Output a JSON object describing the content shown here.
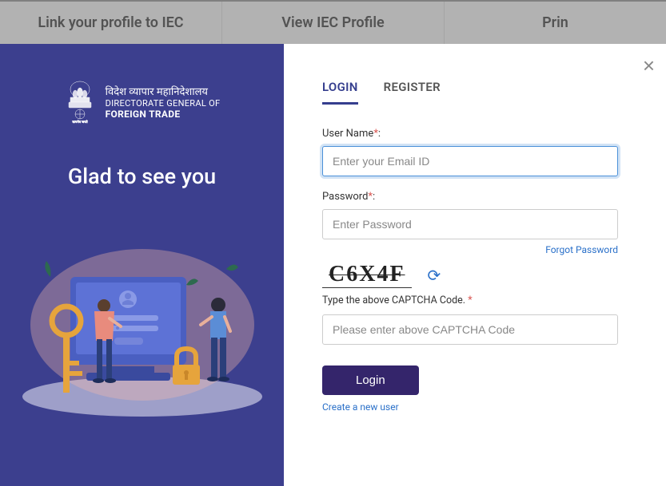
{
  "backgroundTabs": {
    "tab1": "Link your profile to IEC",
    "tab2": "View IEC Profile",
    "tab3": "Prin"
  },
  "org": {
    "hi": "विदेश व्यापार महानिदेशालय",
    "en1": "DIRECTORATE GENERAL OF",
    "en2": "FOREIGN TRADE"
  },
  "welcome": "Glad to see you",
  "tabs": {
    "login": "LOGIN",
    "register": "REGISTER"
  },
  "form": {
    "userNameLabel": "User Name",
    "userNamePlaceholder": "Enter your Email ID",
    "passwordLabel": "Password",
    "passwordPlaceholder": "Enter Password",
    "forgot": "Forgot Password",
    "captchaValue": "C6X4F",
    "captchaLabel": "Type the above CAPTCHA Code.",
    "captchaPlaceholder": "Please enter above CAPTCHA Code",
    "loginBtn": "Login",
    "createLink": "Create a new user"
  },
  "icons": {
    "close": "×",
    "refresh": "⟳"
  }
}
